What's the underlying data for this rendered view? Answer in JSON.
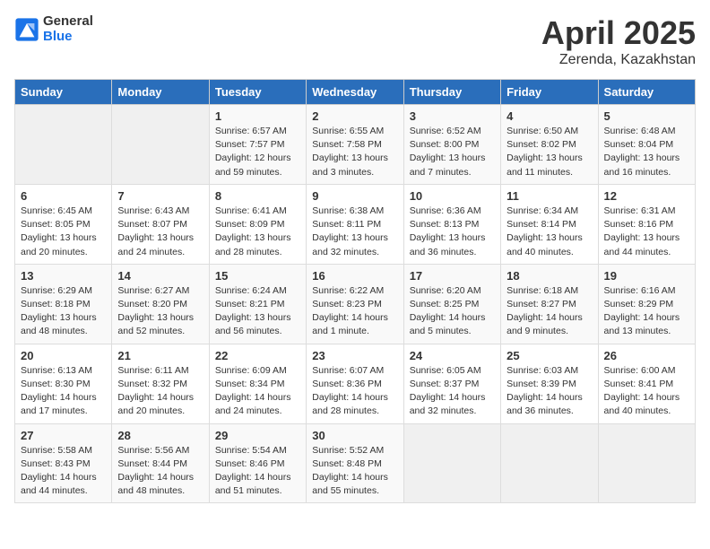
{
  "logo": {
    "general": "General",
    "blue": "Blue"
  },
  "title": "April 2025",
  "subtitle": "Zerenda, Kazakhstan",
  "weekdays": [
    "Sunday",
    "Monday",
    "Tuesday",
    "Wednesday",
    "Thursday",
    "Friday",
    "Saturday"
  ],
  "weeks": [
    [
      {
        "day": "",
        "info": ""
      },
      {
        "day": "",
        "info": ""
      },
      {
        "day": "1",
        "info": "Sunrise: 6:57 AM\nSunset: 7:57 PM\nDaylight: 12 hours\nand 59 minutes."
      },
      {
        "day": "2",
        "info": "Sunrise: 6:55 AM\nSunset: 7:58 PM\nDaylight: 13 hours\nand 3 minutes."
      },
      {
        "day": "3",
        "info": "Sunrise: 6:52 AM\nSunset: 8:00 PM\nDaylight: 13 hours\nand 7 minutes."
      },
      {
        "day": "4",
        "info": "Sunrise: 6:50 AM\nSunset: 8:02 PM\nDaylight: 13 hours\nand 11 minutes."
      },
      {
        "day": "5",
        "info": "Sunrise: 6:48 AM\nSunset: 8:04 PM\nDaylight: 13 hours\nand 16 minutes."
      }
    ],
    [
      {
        "day": "6",
        "info": "Sunrise: 6:45 AM\nSunset: 8:05 PM\nDaylight: 13 hours\nand 20 minutes."
      },
      {
        "day": "7",
        "info": "Sunrise: 6:43 AM\nSunset: 8:07 PM\nDaylight: 13 hours\nand 24 minutes."
      },
      {
        "day": "8",
        "info": "Sunrise: 6:41 AM\nSunset: 8:09 PM\nDaylight: 13 hours\nand 28 minutes."
      },
      {
        "day": "9",
        "info": "Sunrise: 6:38 AM\nSunset: 8:11 PM\nDaylight: 13 hours\nand 32 minutes."
      },
      {
        "day": "10",
        "info": "Sunrise: 6:36 AM\nSunset: 8:13 PM\nDaylight: 13 hours\nand 36 minutes."
      },
      {
        "day": "11",
        "info": "Sunrise: 6:34 AM\nSunset: 8:14 PM\nDaylight: 13 hours\nand 40 minutes."
      },
      {
        "day": "12",
        "info": "Sunrise: 6:31 AM\nSunset: 8:16 PM\nDaylight: 13 hours\nand 44 minutes."
      }
    ],
    [
      {
        "day": "13",
        "info": "Sunrise: 6:29 AM\nSunset: 8:18 PM\nDaylight: 13 hours\nand 48 minutes."
      },
      {
        "day": "14",
        "info": "Sunrise: 6:27 AM\nSunset: 8:20 PM\nDaylight: 13 hours\nand 52 minutes."
      },
      {
        "day": "15",
        "info": "Sunrise: 6:24 AM\nSunset: 8:21 PM\nDaylight: 13 hours\nand 56 minutes."
      },
      {
        "day": "16",
        "info": "Sunrise: 6:22 AM\nSunset: 8:23 PM\nDaylight: 14 hours\nand 1 minute."
      },
      {
        "day": "17",
        "info": "Sunrise: 6:20 AM\nSunset: 8:25 PM\nDaylight: 14 hours\nand 5 minutes."
      },
      {
        "day": "18",
        "info": "Sunrise: 6:18 AM\nSunset: 8:27 PM\nDaylight: 14 hours\nand 9 minutes."
      },
      {
        "day": "19",
        "info": "Sunrise: 6:16 AM\nSunset: 8:29 PM\nDaylight: 14 hours\nand 13 minutes."
      }
    ],
    [
      {
        "day": "20",
        "info": "Sunrise: 6:13 AM\nSunset: 8:30 PM\nDaylight: 14 hours\nand 17 minutes."
      },
      {
        "day": "21",
        "info": "Sunrise: 6:11 AM\nSunset: 8:32 PM\nDaylight: 14 hours\nand 20 minutes."
      },
      {
        "day": "22",
        "info": "Sunrise: 6:09 AM\nSunset: 8:34 PM\nDaylight: 14 hours\nand 24 minutes."
      },
      {
        "day": "23",
        "info": "Sunrise: 6:07 AM\nSunset: 8:36 PM\nDaylight: 14 hours\nand 28 minutes."
      },
      {
        "day": "24",
        "info": "Sunrise: 6:05 AM\nSunset: 8:37 PM\nDaylight: 14 hours\nand 32 minutes."
      },
      {
        "day": "25",
        "info": "Sunrise: 6:03 AM\nSunset: 8:39 PM\nDaylight: 14 hours\nand 36 minutes."
      },
      {
        "day": "26",
        "info": "Sunrise: 6:00 AM\nSunset: 8:41 PM\nDaylight: 14 hours\nand 40 minutes."
      }
    ],
    [
      {
        "day": "27",
        "info": "Sunrise: 5:58 AM\nSunset: 8:43 PM\nDaylight: 14 hours\nand 44 minutes."
      },
      {
        "day": "28",
        "info": "Sunrise: 5:56 AM\nSunset: 8:44 PM\nDaylight: 14 hours\nand 48 minutes."
      },
      {
        "day": "29",
        "info": "Sunrise: 5:54 AM\nSunset: 8:46 PM\nDaylight: 14 hours\nand 51 minutes."
      },
      {
        "day": "30",
        "info": "Sunrise: 5:52 AM\nSunset: 8:48 PM\nDaylight: 14 hours\nand 55 minutes."
      },
      {
        "day": "",
        "info": ""
      },
      {
        "day": "",
        "info": ""
      },
      {
        "day": "",
        "info": ""
      }
    ]
  ]
}
